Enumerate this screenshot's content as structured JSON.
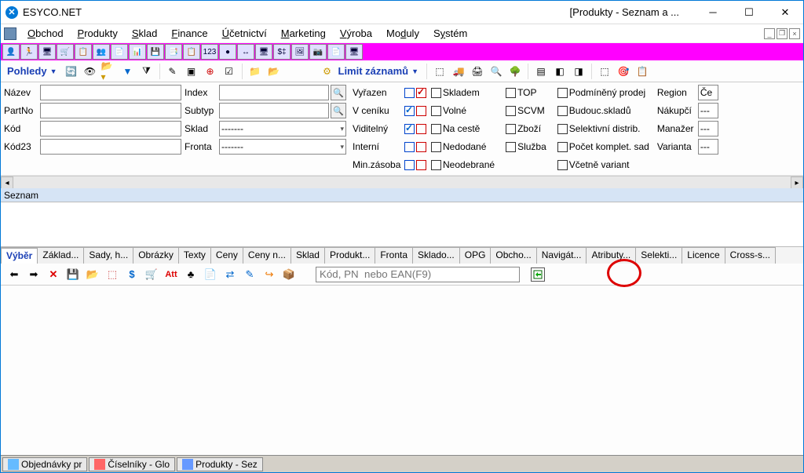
{
  "window": {
    "app_title": "ESYCO.NET",
    "doc_title": "[Produkty - Seznam a ..."
  },
  "menubar": [
    "Obchod",
    "Produkty",
    "Sklad",
    "Finance",
    "Účetnictví",
    "Marketing",
    "Výroba",
    "Moduly",
    "Systém"
  ],
  "toolbar2": {
    "pohledy": "Pohledy",
    "limit": "Limit záznamů"
  },
  "filters": {
    "labels": {
      "nazev": "Název",
      "partno": "PartNo",
      "kod": "Kód",
      "kod23": "Kód23",
      "index": "Index",
      "subtyp": "Subtyp",
      "sklad": "Sklad",
      "fronta": "Fronta"
    },
    "placeholders": {
      "dash": "-------"
    },
    "col3": [
      "Vyřazen",
      "V ceníku",
      "Viditelný",
      "Interní",
      "Min.zásoba"
    ],
    "col4": [
      "Skladem",
      "Volné",
      "Na cestě",
      "Nedodané",
      "Neodebrané"
    ],
    "col5": [
      "TOP",
      "SCVM",
      "Zboží",
      "Služba"
    ],
    "col6": [
      "Podmíněný prodej",
      "Budouc.skladů",
      "Selektivní distrib.",
      "Počet komplet. sad",
      "Včetně variant"
    ],
    "col7": {
      "region": "Region",
      "nakupci": "Nákupčí",
      "manazer": "Manažer",
      "varianta": "Varianta",
      "region_val": "Če",
      "dots": "---"
    }
  },
  "seznam": "Seznam",
  "tabs": [
    "Výběr",
    "Základ...",
    "Sady, h...",
    "Obrázky",
    "Texty",
    "Ceny",
    "Ceny n...",
    "Sklad",
    "Produkt...",
    "Fronta",
    "Sklado...",
    "OPG",
    "Obcho...",
    "Navigát...",
    "Atributy...",
    "Selekti...",
    "Licence",
    "Cross-s..."
  ],
  "search": {
    "placeholder": "Kód, PN  nebo EAN(F9)"
  },
  "taskbar": [
    "Objednávky pr",
    "Číselníky - Glo",
    "Produkty - Sez"
  ]
}
